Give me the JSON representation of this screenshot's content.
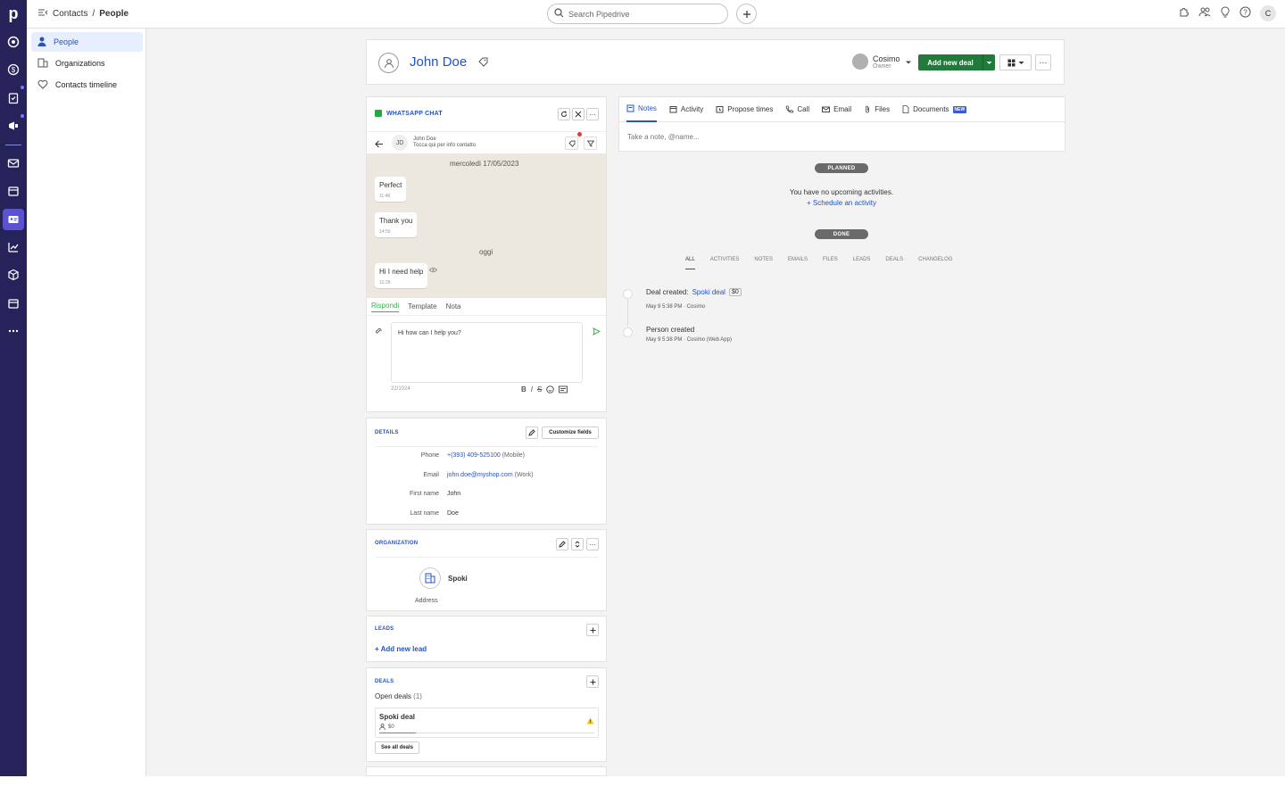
{
  "nav": {
    "logo": "p",
    "icons": [
      "target-icon",
      "dollar-icon",
      "tasks-icon",
      "megaphone-icon",
      "mail-icon",
      "calendar-icon",
      "contacts-icon",
      "chart-icon",
      "box-icon",
      "store-icon",
      "more-icon"
    ]
  },
  "topbar": {
    "breadcrumb_root": "Contacts",
    "breadcrumb_sep": "/",
    "breadcrumb_current": "People",
    "search_placeholder": "Search Pipedrive",
    "avatar_initial": "C"
  },
  "sidebar": {
    "items": [
      {
        "label": "People"
      },
      {
        "label": "Organizations"
      },
      {
        "label": "Contacts timeline"
      }
    ]
  },
  "person": {
    "name": "John Doe",
    "owner_name": "Cosimo",
    "owner_role": "Owner",
    "add_deal_label": "Add new deal"
  },
  "whatsapp": {
    "title": "WHATSAPP CHAT",
    "contact_initials": "JD",
    "contact_name": "John Doe",
    "contact_hint": "Tocca qui per info contatto",
    "date1": "mercoledì 17/05/2023",
    "messages": [
      {
        "text": "Perfect",
        "time": "11:48"
      },
      {
        "text": "Thank you",
        "time": "14:59"
      },
      {
        "text": "Hi I need help",
        "time": "12:28"
      }
    ],
    "date2": "oggi",
    "tabs": [
      "Rispondi",
      "Template",
      "Nota"
    ],
    "input_value": "Hi how can I help you?",
    "char_count": "22/1024"
  },
  "details": {
    "title": "DETAILS",
    "customize_label": "Customize fields",
    "rows": [
      {
        "label": "Phone",
        "value": "+(393) 409-525100",
        "suffix": "(Mobile)"
      },
      {
        "label": "Email",
        "value": "john.doe@myshop.com",
        "suffix": "(Work)"
      },
      {
        "label": "First name",
        "value": "John",
        "suffix": ""
      },
      {
        "label": "Last name",
        "value": "Doe",
        "suffix": ""
      }
    ]
  },
  "organization": {
    "title": "ORGANIZATION",
    "name": "Spoki",
    "address_label": "Address"
  },
  "leads": {
    "title": "LEADS",
    "add_label": "+ Add new lead"
  },
  "deals": {
    "title": "DEALS",
    "open_label": "Open deals",
    "open_count": "(1)",
    "deal_name": "Spoki deal",
    "deal_value": "$0",
    "deal_progress": 0.17,
    "see_all_label": "See all deals"
  },
  "activity_tabs": {
    "tabs": [
      {
        "label": "Notes",
        "icon": "note-icon"
      },
      {
        "label": "Activity",
        "icon": "calendar-icon"
      },
      {
        "label": "Propose times",
        "icon": "clock-icon"
      },
      {
        "label": "Call",
        "icon": "phone-icon"
      },
      {
        "label": "Email",
        "icon": "mail-icon"
      },
      {
        "label": "Files",
        "icon": "paperclip-icon"
      },
      {
        "label": "Documents",
        "icon": "document-icon"
      }
    ],
    "new_badge": "NEW",
    "note_placeholder": "Take a note, @name..."
  },
  "timeline": {
    "planned_label": "PLANNED",
    "no_activities": "You have no upcoming activities.",
    "schedule_link": "+ Schedule an activity",
    "done_label": "DONE",
    "filters": [
      "ALL",
      "ACTIVITIES",
      "NOTES",
      "EMAILS",
      "FILES",
      "LEADS",
      "DEALS",
      "CHANGELOG"
    ],
    "events": [
      {
        "title": "Deal created:",
        "link": "Spoki deal",
        "badge": "$0",
        "meta_date": "May 9 5:38 PM",
        "meta_by": "Cosimo"
      },
      {
        "title": "Person created",
        "link": "",
        "badge": "",
        "meta_date": "May 9 5:38 PM",
        "meta_by": "Cosimo (Web App)"
      }
    ]
  },
  "colors": {
    "nav_bg": "#26235a",
    "accent_blue": "#2153c6",
    "primary_green": "#217a3a",
    "whatsapp_green": "#26a844"
  }
}
